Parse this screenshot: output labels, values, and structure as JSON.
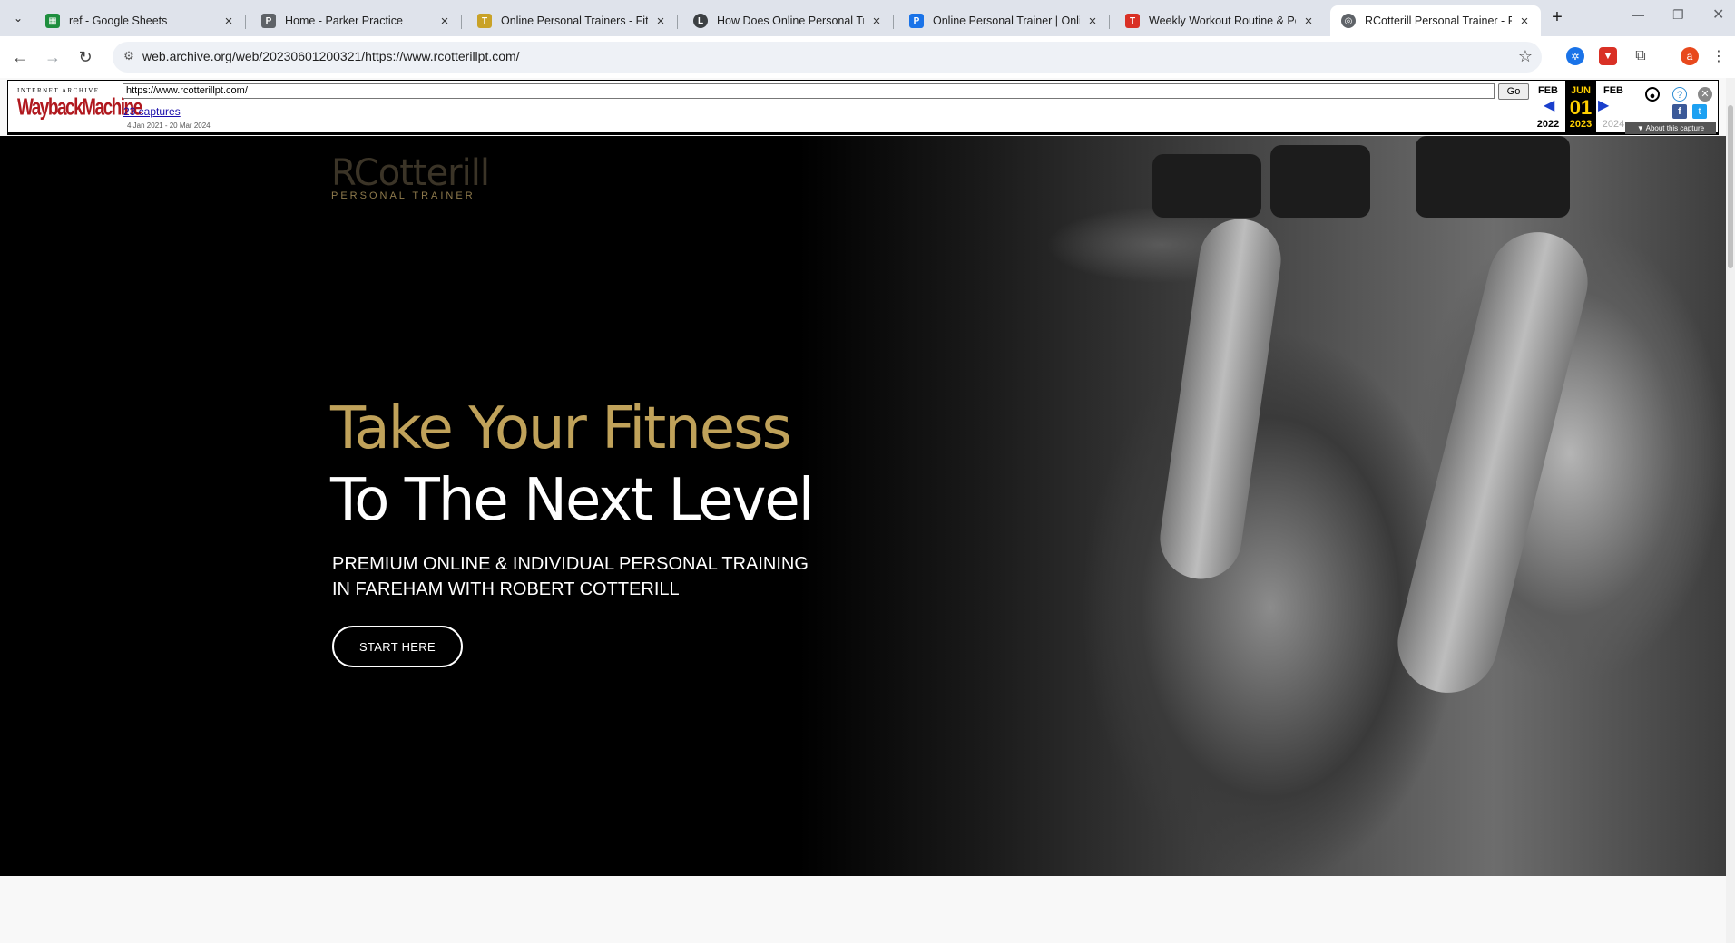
{
  "browser": {
    "tabs": [
      {
        "title": "ref - Google Sheets",
        "favicon_color": "#1e8e3e",
        "favicon_glyph": "▦"
      },
      {
        "title": "Home - Parker Practice",
        "favicon_color": "#5f6368",
        "favicon_glyph": "P"
      },
      {
        "title": "Online Personal Trainers - Fitne",
        "favicon_color": "#c9a227",
        "favicon_glyph": "T"
      },
      {
        "title": "How Does Online Personal Trai",
        "favicon_color": "#3c4043",
        "favicon_glyph": "L"
      },
      {
        "title": "Online Personal Trainer | Online",
        "favicon_color": "#1a73e8",
        "favicon_glyph": "P"
      },
      {
        "title": "Weekly Workout Routine & Per",
        "favicon_color": "#d93025",
        "favicon_glyph": "T"
      },
      {
        "title": "RCotterill Personal Trainer - Per",
        "favicon_color": "#5f6368",
        "favicon_glyph": "◎",
        "active": true
      }
    ],
    "close_glyph": "×",
    "new_tab_glyph": "+",
    "url": "web.archive.org/web/20230601200321/https://www.rcotterillpt.com/",
    "profile_initial": "a"
  },
  "wayback": {
    "brand_top": "INTERNET ARCHIVE",
    "brand_main": "WaybackMachine",
    "url_value": "https://www.rcotterillpt.com/",
    "go_label": "Go",
    "captures_link": "23 captures",
    "date_range": "4 Jan 2021 - 20 Mar 2024",
    "prev": {
      "month": "FEB",
      "year": "2022"
    },
    "current": {
      "month": "JUN",
      "day": "01",
      "year": "2023"
    },
    "next": {
      "month": "FEB",
      "year": "2024"
    },
    "about_label": "▼ About this capture"
  },
  "site": {
    "logo_text": "RCotterill",
    "logo_sub": "PERSONAL TRAINER",
    "headline_gold": "Take Your Fitness",
    "headline_white": "To The Next Level",
    "subheading_line1": "PREMIUM ONLINE & INDIVIDUAL PERSONAL TRAINING",
    "subheading_line2": "IN FAREHAM WITH ROBERT COTTERILL",
    "cta_label": "START HERE"
  }
}
